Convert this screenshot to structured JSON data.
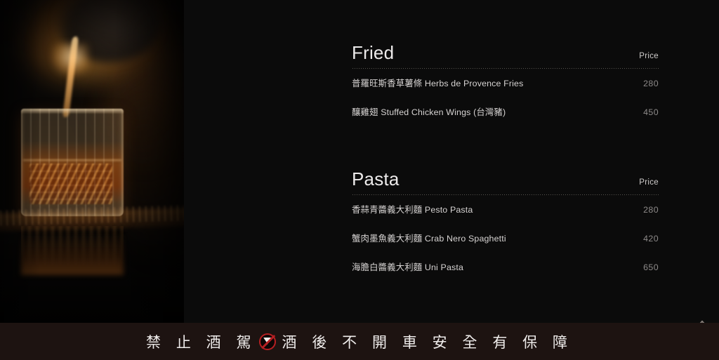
{
  "photo": {
    "alt": "whiskey being poured into a cut-crystal rocks glass on a dark bar counter"
  },
  "menu": {
    "sections": [
      {
        "title": "Fried",
        "price_label": "Price",
        "items": [
          {
            "name": "普羅旺斯香草薯條 Herbs de Provence Fries",
            "price": "280"
          },
          {
            "name": "釀雞翅 Stuffed Chicken Wings (台灣豬)",
            "price": "450"
          }
        ]
      },
      {
        "title": "Pasta",
        "price_label": "Price",
        "items": [
          {
            "name": "香蒜青醬義大利麵 Pesto Pasta",
            "price": "280"
          },
          {
            "name": "蟹肉墨魚義大利麵 Crab Nero Spaghetti",
            "price": "420"
          },
          {
            "name": "海膽白醬義大利麵 Uni Pasta",
            "price": "650"
          }
        ]
      }
    ]
  },
  "warning_banner": {
    "text_before": "禁 止 酒 駕",
    "icon": "no-drinking-icon",
    "text_after": "酒 後 不 開 車 安 全 有 保 障",
    "icon_color": "#b61f22",
    "background": "#1d1311"
  },
  "scroll_top": {
    "icon": "arrow-up-icon",
    "color": "#8a817d"
  }
}
